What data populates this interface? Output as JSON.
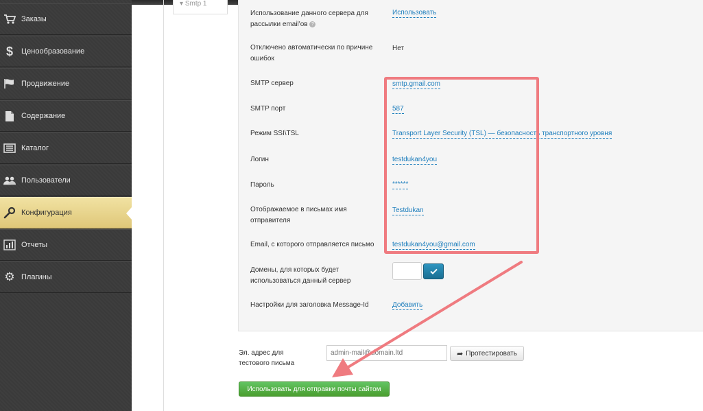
{
  "sidebar": {
    "items": [
      {
        "label": "Заказы",
        "icon": "cart-icon",
        "name": "sidebar-item-orders"
      },
      {
        "label": "Ценообразование",
        "icon": "dollar-icon",
        "name": "sidebar-item-pricing"
      },
      {
        "label": "Продвижение",
        "icon": "flag-icon",
        "name": "sidebar-item-promotion"
      },
      {
        "label": "Содержание",
        "icon": "document-icon",
        "name": "sidebar-item-content"
      },
      {
        "label": "Каталог",
        "icon": "catalog-icon",
        "name": "sidebar-item-catalog"
      },
      {
        "label": "Пользователи",
        "icon": "users-icon",
        "name": "sidebar-item-users"
      },
      {
        "label": "Конфигурация",
        "icon": "wrench-icon",
        "name": "sidebar-item-configuration",
        "active": true
      },
      {
        "label": "Отчеты",
        "icon": "bar-chart-icon",
        "name": "sidebar-item-reports"
      },
      {
        "label": "Плагины",
        "icon": "gear-icon",
        "name": "sidebar-item-plugins"
      }
    ]
  },
  "tab": {
    "label": "Smtp 1"
  },
  "form": {
    "use_server_label": "Использование данного сервера для рассылки email'ов",
    "use_server_value": "Использовать",
    "disabled_label": "Отключено автоматически по причине ошибок",
    "disabled_value": "Нет",
    "smtp_server_label": "SMTP сервер",
    "smtp_server_value": "smtp.gmail.com",
    "smtp_port_label": "SMTP порт",
    "smtp_port_value": "587",
    "ssl_label": "Режим SSI\\TSL",
    "ssl_value": "Transport Layer Security (TSL) — безопасность транспортного уровня",
    "login_label": "Логин",
    "login_value": "testdukan4you",
    "password_label": "Пароль",
    "password_value": "******",
    "sender_name_label": "Отображаемое в письмах имя отправителя",
    "sender_name_value": "Testdukan",
    "sender_email_label": "Email, с которого отправляется письмо",
    "sender_email_value": "testdukan4you@gmail.com",
    "domains_label": "Домены, для которых будет использоваться данный сервер",
    "message_id_label": "Настройки для заголовка Message-Id",
    "message_id_value": "Добавить"
  },
  "test": {
    "label": "Эл. адрес для тестового письма",
    "placeholder": "admin-mail@domain.ltd",
    "button_label": "Протестировать"
  },
  "submit": {
    "label": "Использовать для отправки почты сайтом"
  },
  "colors": {
    "accent": "#1f7fbd",
    "highlight": "#ef7b80",
    "active_nav": "#e8d48c",
    "primary_button": "#4a9e2f"
  }
}
